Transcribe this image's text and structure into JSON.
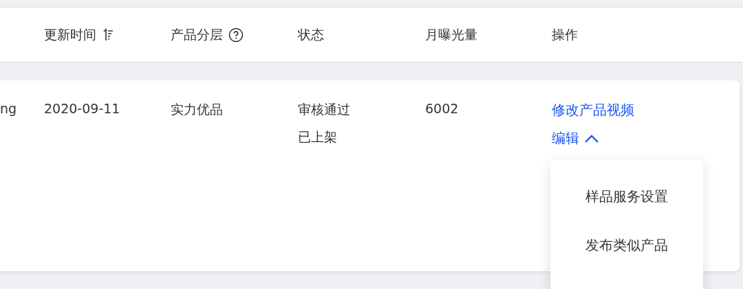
{
  "table": {
    "columns": [
      {
        "label": "更新时间",
        "kind": "sortable"
      },
      {
        "label": "产品分层",
        "kind": "help"
      },
      {
        "label": "状态",
        "kind": "plain"
      },
      {
        "label": "月曝光量",
        "kind": "plain"
      },
      {
        "label": "操作",
        "kind": "plain"
      }
    ],
    "rows": [
      {
        "column_1": "ng",
        "updated": "2020-09-11",
        "tier": "实力优品",
        "status": [
          "审核通过",
          "已上架"
        ],
        "views": "6002",
        "actions": [
          {
            "label": "修改产品视频",
            "kind": "link"
          },
          {
            "label": "编辑",
            "kind": "menu",
            "expanded": true,
            "menu_items": [
              "样品服务设置",
              "发布类似产品"
            ]
          }
        ]
      }
    ]
  }
}
